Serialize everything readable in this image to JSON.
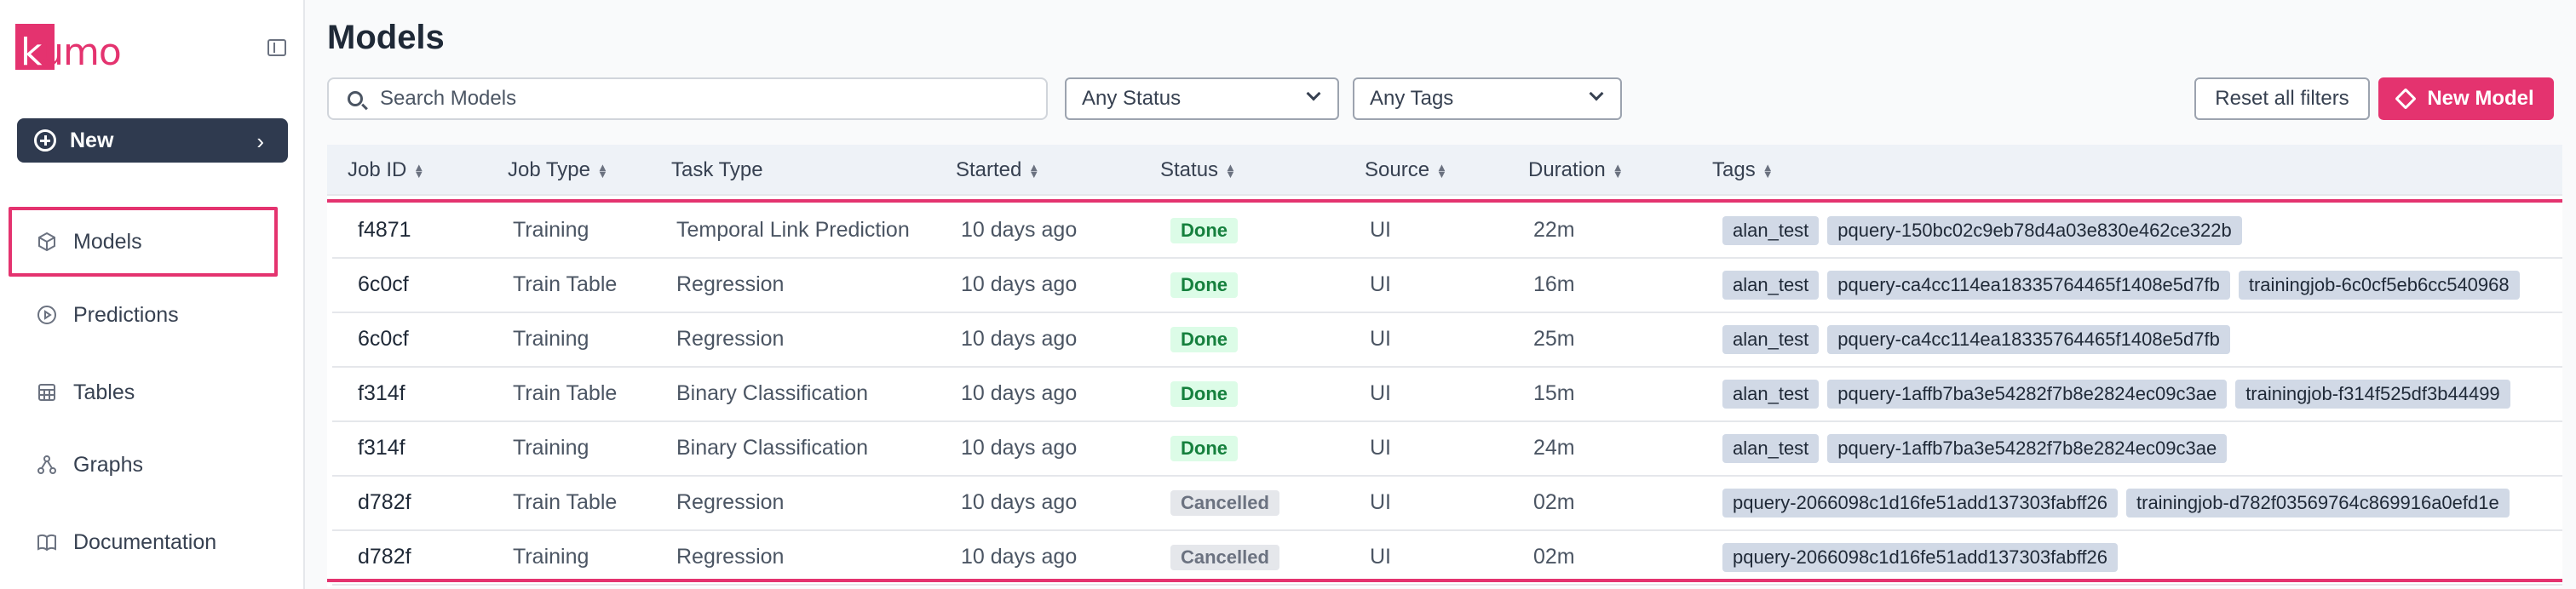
{
  "brand": {
    "logo_text_k": "k",
    "logo_text_rest": "umo",
    "accent": "#e4336f"
  },
  "sidebar": {
    "new_label": "New",
    "items": [
      {
        "label": "Models",
        "icon": "cube-icon",
        "active": true
      },
      {
        "label": "Predictions",
        "icon": "play-circle-icon"
      },
      {
        "label": "Tables",
        "icon": "table-icon"
      },
      {
        "label": "Graphs",
        "icon": "graph-icon"
      },
      {
        "label": "Documentation",
        "icon": "book-icon"
      }
    ]
  },
  "header": {
    "title": "Models"
  },
  "filters": {
    "search_placeholder": "Search Models",
    "status": "Any Status",
    "tags": "Any Tags",
    "reset_label": "Reset all filters",
    "new_model_label": "New Model"
  },
  "table": {
    "columns": [
      "Job ID",
      "Job Type",
      "Task Type",
      "Started",
      "Status",
      "Source",
      "Duration",
      "Tags"
    ],
    "rows": [
      {
        "id": "f4871",
        "job_type": "Training",
        "task_type": "Temporal Link Prediction",
        "started": "10 days ago",
        "status": "Done",
        "source": "UI",
        "duration": "22m",
        "tags": [
          "alan_test",
          "pquery-150bc02c9eb78d4a03e830e462ce322b"
        ]
      },
      {
        "id": "6c0cf",
        "job_type": "Train Table",
        "task_type": "Regression",
        "started": "10 days ago",
        "status": "Done",
        "source": "UI",
        "duration": "16m",
        "tags": [
          "alan_test",
          "pquery-ca4cc114ea18335764465f1408e5d7fb",
          "trainingjob-6c0cf5eb6cc540968"
        ]
      },
      {
        "id": "6c0cf",
        "job_type": "Training",
        "task_type": "Regression",
        "started": "10 days ago",
        "status": "Done",
        "source": "UI",
        "duration": "25m",
        "tags": [
          "alan_test",
          "pquery-ca4cc114ea18335764465f1408e5d7fb"
        ]
      },
      {
        "id": "f314f",
        "job_type": "Train Table",
        "task_type": "Binary Classification",
        "started": "10 days ago",
        "status": "Done",
        "source": "UI",
        "duration": "15m",
        "tags": [
          "alan_test",
          "pquery-1affb7ba3e54282f7b8e2824ec09c3ae",
          "trainingjob-f314f525df3b44499"
        ]
      },
      {
        "id": "f314f",
        "job_type": "Training",
        "task_type": "Binary Classification",
        "started": "10 days ago",
        "status": "Done",
        "source": "UI",
        "duration": "24m",
        "tags": [
          "alan_test",
          "pquery-1affb7ba3e54282f7b8e2824ec09c3ae"
        ]
      },
      {
        "id": "d782f",
        "job_type": "Train Table",
        "task_type": "Regression",
        "started": "10 days ago",
        "status": "Cancelled",
        "source": "UI",
        "duration": "02m",
        "tags": [
          "pquery-2066098c1d16fe51add137303fabff26",
          "trainingjob-d782f03569764c869916a0efd1e"
        ]
      },
      {
        "id": "d782f",
        "job_type": "Training",
        "task_type": "Regression",
        "started": "10 days ago",
        "status": "Cancelled",
        "source": "UI",
        "duration": "02m",
        "tags": [
          "pquery-2066098c1d16fe51add137303fabff26"
        ]
      }
    ]
  }
}
